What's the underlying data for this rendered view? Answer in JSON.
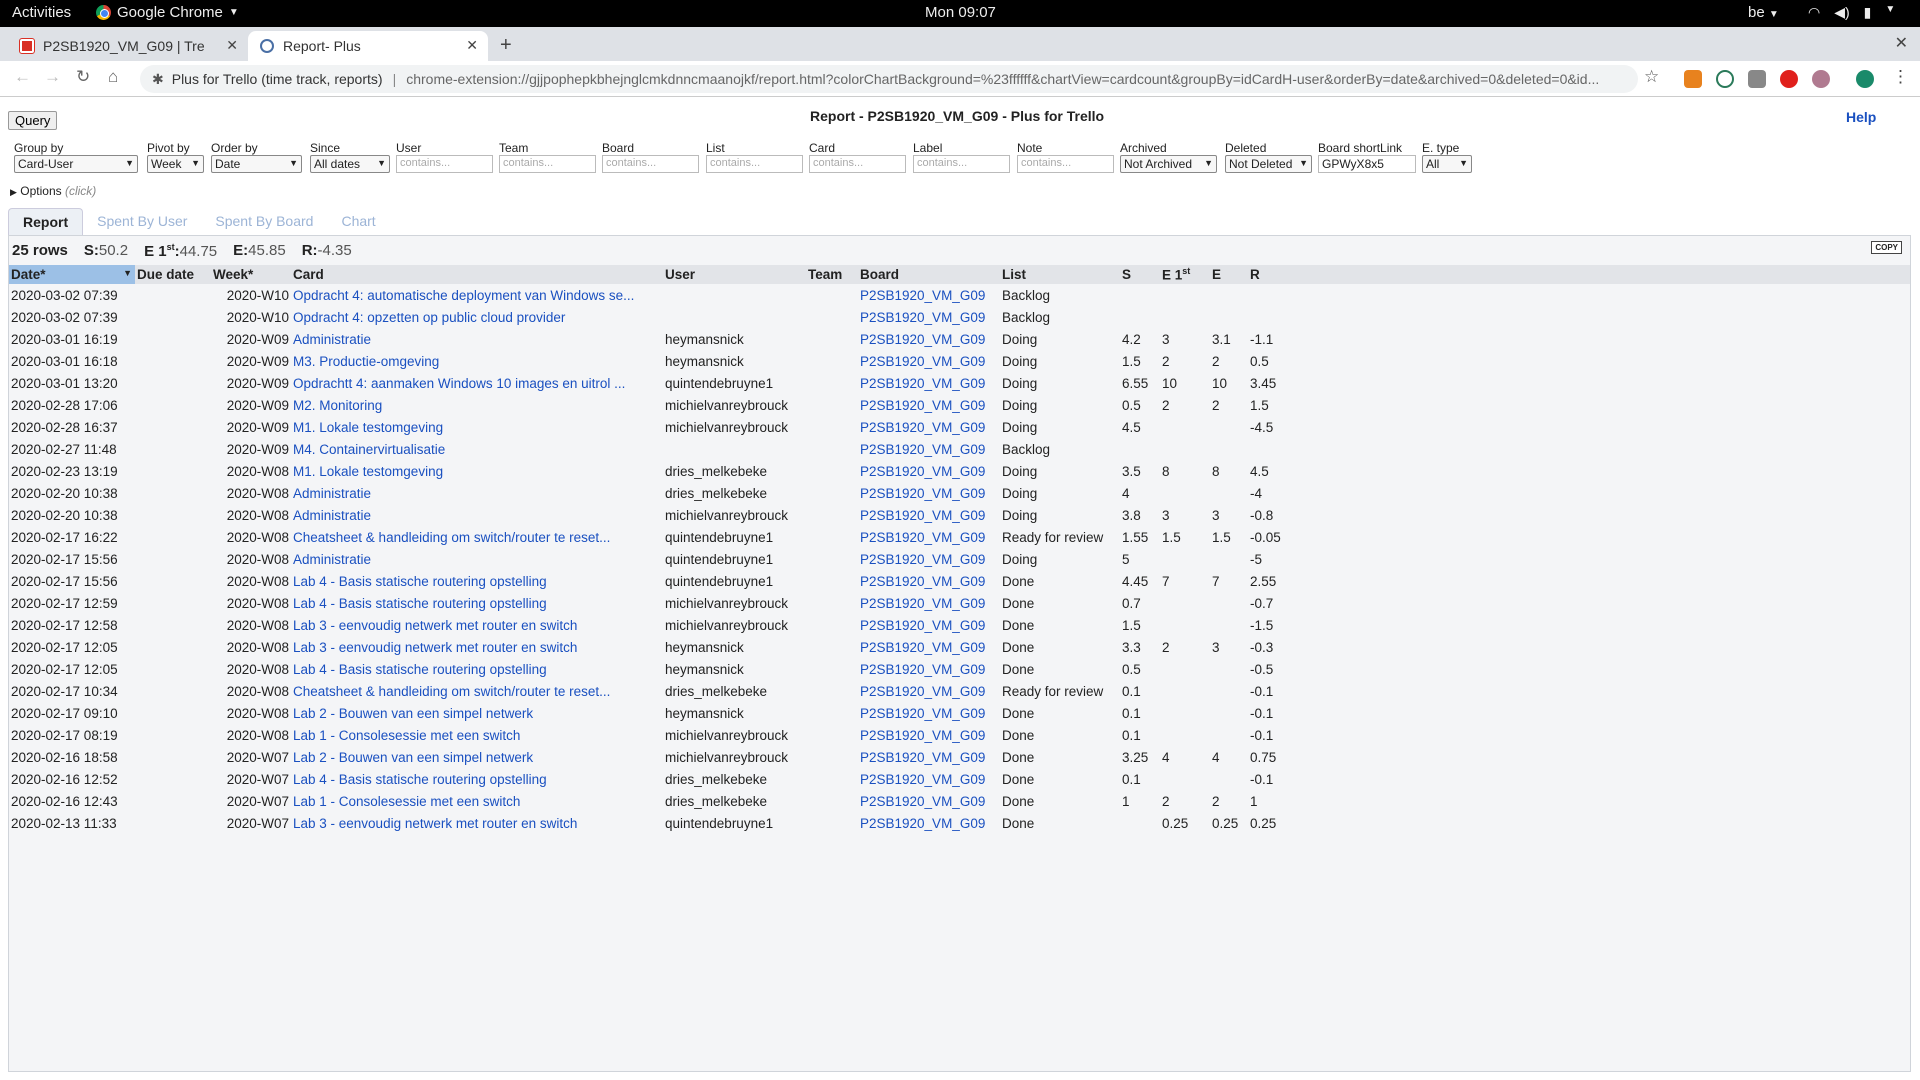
{
  "topbar": {
    "activities": "Activities",
    "app": "Google Chrome",
    "clock": "Mon 09:07",
    "keyboard": "be"
  },
  "tabs": [
    {
      "label": "P2SB1920_VM_G09 | Tre"
    },
    {
      "label": "Report- Plus"
    }
  ],
  "omnibox": {
    "ext_name": "Plus for Trello (time track, reports)",
    "url": "chrome-extension://gjjpophepkbhejnglcmkdnncmaanojkf/report.html?colorChartBackground=%23ffffff&chartView=cardcount&groupBy=idCardH-user&orderBy=date&archived=0&deleted=0&id..."
  },
  "page": {
    "query_label": "Query",
    "title": "Report - P2SB1920_VM_G09 - Plus for Trello",
    "help": "Help"
  },
  "filters": {
    "group_by": {
      "label": "Group by",
      "value": "Card-User"
    },
    "pivot_by": {
      "label": "Pivot by",
      "value": "Week"
    },
    "order_by": {
      "label": "Order by",
      "value": "Date"
    },
    "since": {
      "label": "Since",
      "value": "All dates"
    },
    "user": {
      "label": "User",
      "placeholder": "contains..."
    },
    "team": {
      "label": "Team",
      "placeholder": "contains..."
    },
    "board": {
      "label": "Board",
      "placeholder": "contains..."
    },
    "list": {
      "label": "List",
      "placeholder": "contains..."
    },
    "card": {
      "label": "Card",
      "placeholder": "contains..."
    },
    "label": {
      "label": "Label",
      "placeholder": "contains..."
    },
    "note": {
      "label": "Note",
      "placeholder": "contains..."
    },
    "archived": {
      "label": "Archived",
      "value": "Not Archived"
    },
    "deleted": {
      "label": "Deleted",
      "value": "Not Deleted"
    },
    "shortlink": {
      "label": "Board shortLink",
      "value": "GPWyX8x5"
    },
    "etype": {
      "label": "E. type",
      "value": "All"
    }
  },
  "options": {
    "label": "Options",
    "hint": "(click)"
  },
  "report_tabs": [
    "Report",
    "Spent By User",
    "Spent By Board",
    "Chart"
  ],
  "summary": {
    "rows": "25 rows",
    "s_label": "S:",
    "s": "50.2",
    "e1_label": "E 1",
    "e1_sup": "st",
    "e1": "44.75",
    "e_label": "E:",
    "e": "45.85",
    "r_label": "R:",
    "r": "-4.35",
    "copy": "COPY"
  },
  "columns": {
    "date": "Date*",
    "due": "Due date",
    "week": "Week*",
    "card": "Card",
    "user": "User",
    "team": "Team",
    "board": "Board",
    "list": "List",
    "s": "S",
    "e1": "E 1",
    "e1_sup": "st",
    "e": "E",
    "r": "R"
  },
  "rows": [
    {
      "date": "2020-03-02 07:39",
      "week": "2020-W10",
      "card": "Opdracht 4: automatische deployment van Windows se...",
      "user": "",
      "board": "P2SB1920_VM_G09",
      "list": "Backlog",
      "s": "",
      "e1": "",
      "e": "",
      "r": ""
    },
    {
      "date": "2020-03-02 07:39",
      "week": "2020-W10",
      "card": "Opdracht 4: opzetten op public cloud provider",
      "user": "",
      "board": "P2SB1920_VM_G09",
      "list": "Backlog",
      "s": "",
      "e1": "",
      "e": "",
      "r": ""
    },
    {
      "date": "2020-03-01 16:19",
      "week": "2020-W09",
      "card": "Administratie",
      "user": "heymansnick",
      "board": "P2SB1920_VM_G09",
      "list": "Doing",
      "s": "4.2",
      "e1": "3",
      "e": "3.1",
      "r": "-1.1"
    },
    {
      "date": "2020-03-01 16:18",
      "week": "2020-W09",
      "card": "M3. Productie-omgeving",
      "user": "heymansnick",
      "board": "P2SB1920_VM_G09",
      "list": "Doing",
      "s": "1.5",
      "e1": "2",
      "e": "2",
      "r": "0.5"
    },
    {
      "date": "2020-03-01 13:20",
      "week": "2020-W09",
      "card": "Opdrachtt 4: aanmaken Windows 10 images en uitrol ...",
      "user": "quintendebruyne1",
      "board": "P2SB1920_VM_G09",
      "list": "Doing",
      "s": "6.55",
      "e1": "10",
      "e": "10",
      "r": "3.45"
    },
    {
      "date": "2020-02-28 17:06",
      "week": "2020-W09",
      "card": "M2. Monitoring",
      "user": "michielvanreybrouck",
      "board": "P2SB1920_VM_G09",
      "list": "Doing",
      "s": "0.5",
      "e1": "2",
      "e": "2",
      "r": "1.5"
    },
    {
      "date": "2020-02-28 16:37",
      "week": "2020-W09",
      "card": "M1. Lokale testomgeving",
      "user": "michielvanreybrouck",
      "board": "P2SB1920_VM_G09",
      "list": "Doing",
      "s": "4.5",
      "e1": "",
      "e": "",
      "r": "-4.5"
    },
    {
      "date": "2020-02-27 11:48",
      "week": "2020-W09",
      "card": "M4. Containervirtualisatie",
      "user": "",
      "board": "P2SB1920_VM_G09",
      "list": "Backlog",
      "s": "",
      "e1": "",
      "e": "",
      "r": ""
    },
    {
      "date": "2020-02-23 13:19",
      "week": "2020-W08",
      "card": "M1. Lokale testomgeving",
      "user": "dries_melkebeke",
      "board": "P2SB1920_VM_G09",
      "list": "Doing",
      "s": "3.5",
      "e1": "8",
      "e": "8",
      "r": "4.5"
    },
    {
      "date": "2020-02-20 10:38",
      "week": "2020-W08",
      "card": "Administratie",
      "user": "dries_melkebeke",
      "board": "P2SB1920_VM_G09",
      "list": "Doing",
      "s": "4",
      "e1": "",
      "e": "",
      "r": "-4"
    },
    {
      "date": "2020-02-20 10:38",
      "week": "2020-W08",
      "card": "Administratie",
      "user": "michielvanreybrouck",
      "board": "P2SB1920_VM_G09",
      "list": "Doing",
      "s": "3.8",
      "e1": "3",
      "e": "3",
      "r": "-0.8"
    },
    {
      "date": "2020-02-17 16:22",
      "week": "2020-W08",
      "card": "Cheatsheet & handleiding om switch/router te reset...",
      "user": "quintendebruyne1",
      "board": "P2SB1920_VM_G09",
      "list": "Ready for review",
      "s": "1.55",
      "e1": "1.5",
      "e": "1.5",
      "r": "-0.05"
    },
    {
      "date": "2020-02-17 15:56",
      "week": "2020-W08",
      "card": "Administratie",
      "user": "quintendebruyne1",
      "board": "P2SB1920_VM_G09",
      "list": "Doing",
      "s": "5",
      "e1": "",
      "e": "",
      "r": "-5"
    },
    {
      "date": "2020-02-17 15:56",
      "week": "2020-W08",
      "card": "Lab 4 - Basis statische routering opstelling",
      "user": "quintendebruyne1",
      "board": "P2SB1920_VM_G09",
      "list": "Done",
      "s": "4.45",
      "e1": "7",
      "e": "7",
      "r": "2.55"
    },
    {
      "date": "2020-02-17 12:59",
      "week": "2020-W08",
      "card": "Lab 4 - Basis statische routering opstelling",
      "user": "michielvanreybrouck",
      "board": "P2SB1920_VM_G09",
      "list": "Done",
      "s": "0.7",
      "e1": "",
      "e": "",
      "r": "-0.7"
    },
    {
      "date": "2020-02-17 12:58",
      "week": "2020-W08",
      "card": "Lab 3 - eenvoudig netwerk met router en switch",
      "user": "michielvanreybrouck",
      "board": "P2SB1920_VM_G09",
      "list": "Done",
      "s": "1.5",
      "e1": "",
      "e": "",
      "r": "-1.5"
    },
    {
      "date": "2020-02-17 12:05",
      "week": "2020-W08",
      "card": "Lab 3 - eenvoudig netwerk met router en switch",
      "user": "heymansnick",
      "board": "P2SB1920_VM_G09",
      "list": "Done",
      "s": "3.3",
      "e1": "2",
      "e": "3",
      "r": "-0.3"
    },
    {
      "date": "2020-02-17 12:05",
      "week": "2020-W08",
      "card": "Lab 4 - Basis statische routering opstelling",
      "user": "heymansnick",
      "board": "P2SB1920_VM_G09",
      "list": "Done",
      "s": "0.5",
      "e1": "",
      "e": "",
      "r": "-0.5"
    },
    {
      "date": "2020-02-17 10:34",
      "week": "2020-W08",
      "card": "Cheatsheet & handleiding om switch/router te reset...",
      "user": "dries_melkebeke",
      "board": "P2SB1920_VM_G09",
      "list": "Ready for review",
      "s": "0.1",
      "e1": "",
      "e": "",
      "r": "-0.1"
    },
    {
      "date": "2020-02-17 09:10",
      "week": "2020-W08",
      "card": "Lab 2 - Bouwen van een simpel netwerk",
      "user": "heymansnick",
      "board": "P2SB1920_VM_G09",
      "list": "Done",
      "s": "0.1",
      "e1": "",
      "e": "",
      "r": "-0.1"
    },
    {
      "date": "2020-02-17 08:19",
      "week": "2020-W08",
      "card": "Lab 1 - Consolesessie met een switch",
      "user": "michielvanreybrouck",
      "board": "P2SB1920_VM_G09",
      "list": "Done",
      "s": "0.1",
      "e1": "",
      "e": "",
      "r": "-0.1"
    },
    {
      "date": "2020-02-16 18:58",
      "week": "2020-W07",
      "card": "Lab 2 - Bouwen van een simpel netwerk",
      "user": "michielvanreybrouck",
      "board": "P2SB1920_VM_G09",
      "list": "Done",
      "s": "3.25",
      "e1": "4",
      "e": "4",
      "r": "0.75"
    },
    {
      "date": "2020-02-16 12:52",
      "week": "2020-W07",
      "card": "Lab 4 - Basis statische routering opstelling",
      "user": "dries_melkebeke",
      "board": "P2SB1920_VM_G09",
      "list": "Done",
      "s": "0.1",
      "e1": "",
      "e": "",
      "r": "-0.1"
    },
    {
      "date": "2020-02-16 12:43",
      "week": "2020-W07",
      "card": "Lab 1 - Consolesessie met een switch",
      "user": "dries_melkebeke",
      "board": "P2SB1920_VM_G09",
      "list": "Done",
      "s": "1",
      "e1": "2",
      "e": "2",
      "r": "1"
    },
    {
      "date": "2020-02-13 11:33",
      "week": "2020-W07",
      "card": "Lab 3 - eenvoudig netwerk met router en switch",
      "user": "quintendebruyne1",
      "board": "P2SB1920_VM_G09",
      "list": "Done",
      "s": "",
      "e1": "0.25",
      "e": "0.25",
      "r": "0.25"
    }
  ]
}
